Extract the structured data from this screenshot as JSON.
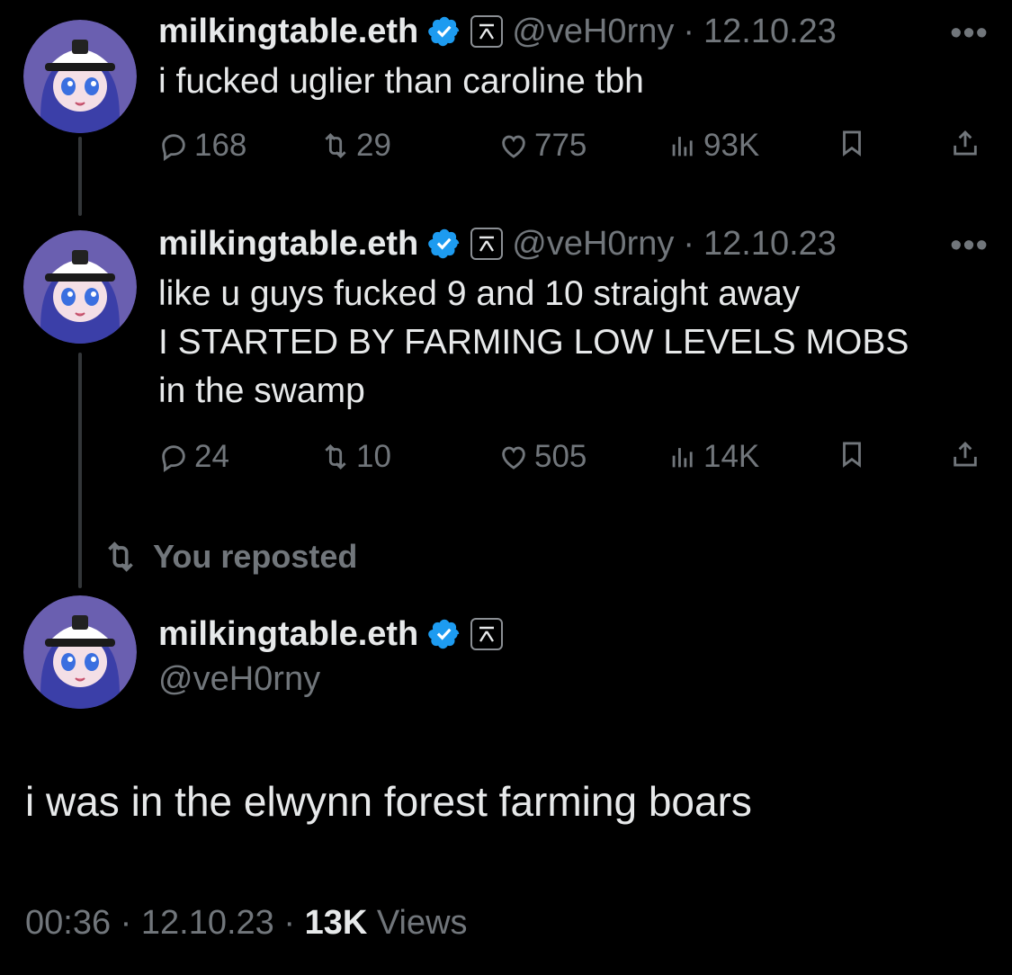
{
  "colors": {
    "background": "#000000",
    "text": "#e7e9ea",
    "muted": "#71767b",
    "verified": "#1d9bf0"
  },
  "tweets": [
    {
      "display_name": "milkingtable.eth",
      "handle": "@veH0rny",
      "date": "12.10.23",
      "separator": "·",
      "text": "i fucked uglier than caroline tbh",
      "replies": "168",
      "reposts": "29",
      "likes": "775",
      "views": "93K",
      "icons": [
        "reply-icon",
        "repost-icon",
        "like-icon",
        "views-icon",
        "bookmark-icon",
        "share-icon",
        "more-icon"
      ]
    },
    {
      "display_name": "milkingtable.eth",
      "handle": "@veH0rny",
      "date": "12.10.23",
      "separator": "·",
      "text": "like u guys fucked 9 and 10 straight away\nI STARTED BY FARMING LOW LEVELS MOBS\nin the swamp",
      "replies": "24",
      "reposts": "10",
      "likes": "505",
      "views": "14K"
    }
  ],
  "repost_context": "You reposted",
  "main_tweet": {
    "display_name": "milkingtable.eth",
    "handle": "@veH0rny",
    "text": "i was in the elwynn forest farming boars",
    "time": "00:36",
    "date": "12.10.23",
    "sep": "·",
    "views_count": "13K",
    "views_label": "Views"
  },
  "affiliate_glyph": "⌅",
  "more_glyph": "•••"
}
